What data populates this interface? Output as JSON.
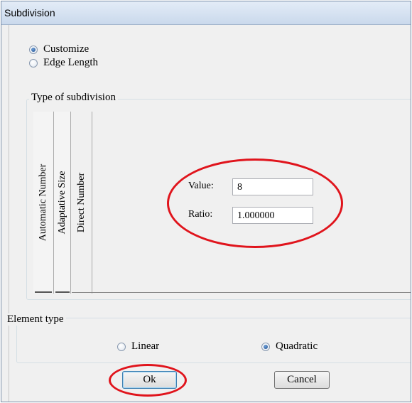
{
  "window": {
    "title": "Subdivision"
  },
  "mode": {
    "options": [
      {
        "label": "Customize",
        "selected": true
      },
      {
        "label": "Edge Length",
        "selected": false
      }
    ]
  },
  "subdivision": {
    "group_label": "Type of subdivision",
    "tabs": [
      {
        "label": "Automatic Number"
      },
      {
        "label": "Adaptative  Size"
      },
      {
        "label": "Direct Number"
      }
    ],
    "value_label": "Value:",
    "value": "8",
    "ratio_label": "Ratio:",
    "ratio": "1.000000"
  },
  "element_type": {
    "group_label": "Element type",
    "options": [
      {
        "label": "Linear",
        "selected": false
      },
      {
        "label": "Quadratic",
        "selected": true
      }
    ]
  },
  "buttons": {
    "ok": "Ok",
    "cancel": "Cancel"
  },
  "annotations": {
    "highlight_color": "#e0141c"
  }
}
